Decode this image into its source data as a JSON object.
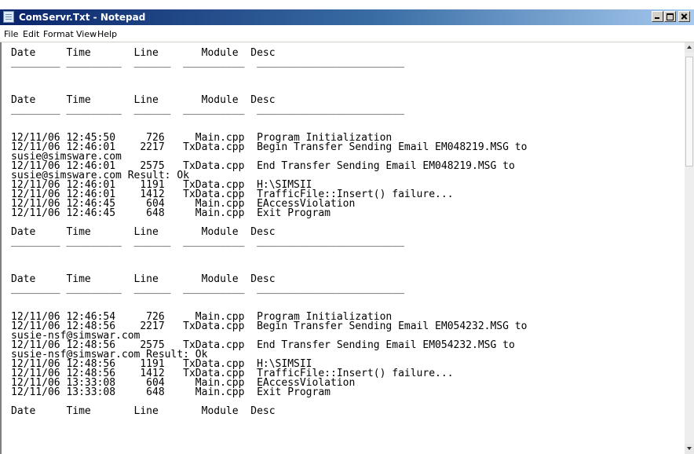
{
  "window": {
    "title": "ComServr.Txt - Notepad",
    "icon": "notepad-icon"
  },
  "menu": [
    "File",
    "Edit",
    "Format",
    "View",
    "Help"
  ],
  "content": {
    "lines": [
      "Date     Time       Line       Module  Desc",
      "________ _________  ______  __________  ________________________",
      "",
      "",
      "",
      "Date     Time       Line       Module  Desc",
      "________ _________  ______  __________  ________________________",
      "",
      "",
      "12/11/06 12:45:50     726     Main.cpp  Program Initialization",
      "12/11/06 12:46:01    2217   TxData.cpp  Begin Transfer Sending Email EM048219.MSG to",
      "susie@simsware.com",
      "12/11/06 12:46:01    2575   TxData.cpp  End Transfer Sending Email EM048219.MSG to",
      "susie@simsware.com Result: Ok",
      "12/11/06 12:46:01    1191   TxData.cpp  H:\\SIMSII",
      "12/11/06 12:46:01    1412   TxData.cpp  TrafficFile::Insert() failure...",
      "12/11/06 12:46:45     604     Main.cpp  EAccessViolation",
      "12/11/06 12:46:45     648     Main.cpp  Exit Program",
      "",
      "Date     Time       Line       Module  Desc",
      "________ _________  ______  __________  ________________________",
      "",
      "",
      "",
      "Date     Time       Line       Module  Desc",
      "________ _________  ______  __________  ________________________",
      "",
      "",
      "12/11/06 12:46:54     726     Main.cpp  Program Initialization",
      "12/11/06 12:48:56    2217   TxData.cpp  Begin Transfer Sending Email EM054232.MSG to",
      "susie-nsf@simswar.com",
      "12/11/06 12:48:56    2575   TxData.cpp  End Transfer Sending Email EM054232.MSG to",
      "susie-nsf@simswar.com Result: Ok",
      "12/11/06 12:48:56    1191   TxData.cpp  H:\\SIMSII",
      "12/11/06 12:48:56    1412   TxData.cpp  TrafficFile::Insert() failure...",
      "12/11/06 13:33:08     604     Main.cpp  EAccessViolation",
      "12/11/06 13:33:08     648     Main.cpp  Exit Program",
      "",
      "Date     Time       Line       Module  Desc"
    ]
  },
  "controls": {
    "minimize": "minimize-icon",
    "maximize": "maximize-icon",
    "close": "close-icon"
  }
}
